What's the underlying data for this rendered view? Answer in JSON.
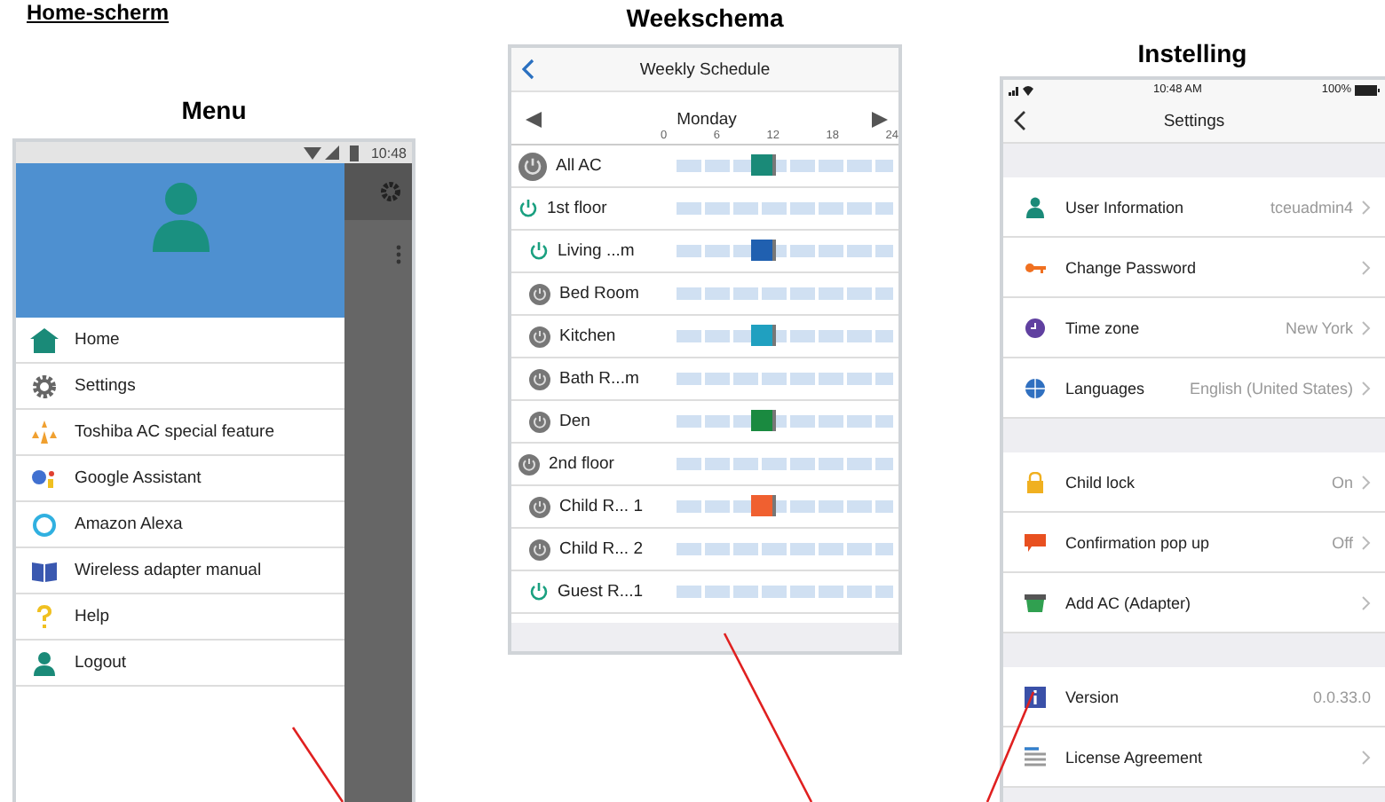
{
  "page_heading": "Home-scherm",
  "menu": {
    "heading": "Menu",
    "status_time": "10:48",
    "items": [
      {
        "kind": "home",
        "label": "Home"
      },
      {
        "kind": "gear",
        "label": "Settings"
      },
      {
        "kind": "stars",
        "label": "Toshiba AC special feature"
      },
      {
        "kind": "dots",
        "label": "Google Assistant"
      },
      {
        "kind": "ring",
        "label": "Amazon Alexa"
      },
      {
        "kind": "book",
        "label": "Wireless adapter manual"
      },
      {
        "kind": "question",
        "label": "Help"
      },
      {
        "kind": "person",
        "label": "Logout"
      }
    ]
  },
  "schedule": {
    "heading": "Weekschema",
    "title": "Weekly Schedule",
    "day": "Monday",
    "ticks": [
      "0",
      "6",
      "12",
      "18",
      "24"
    ],
    "rows": [
      {
        "name": "All AC",
        "on": false,
        "color": "#1a8a78",
        "children": []
      },
      {
        "name": "1st floor",
        "on": true,
        "children": [
          {
            "name": "Living ...m",
            "on": true,
            "color": "#2060b0"
          },
          {
            "name": "Bed Room",
            "on": false
          },
          {
            "name": "Kitchen",
            "on": false,
            "color": "#20a0c0"
          },
          {
            "name": "Bath R...m",
            "on": false
          },
          {
            "name": "Den",
            "on": false,
            "color": "#1a8a40"
          }
        ]
      },
      {
        "name": "2nd floor",
        "on": false,
        "children": [
          {
            "name": "Child R... 1",
            "on": false,
            "color": "#f06030"
          },
          {
            "name": "Child R... 2",
            "on": false
          },
          {
            "name": "Guest R...1",
            "on": true
          }
        ]
      }
    ]
  },
  "settings": {
    "heading": "Instelling",
    "status_time": "10:48 AM",
    "battery": "100%",
    "title": "Settings",
    "groups": [
      [
        {
          "kind": "person",
          "label": "User Information",
          "value": "tceuadmin4",
          "chevron": true
        },
        {
          "kind": "key",
          "label": "Change Password",
          "chevron": true
        },
        {
          "kind": "clock",
          "label": "Time zone",
          "value": "New York",
          "chevron": true
        },
        {
          "kind": "globe",
          "label": "Languages",
          "value": "English (United States)",
          "chevron": true
        }
      ],
      [
        {
          "kind": "lock",
          "label": "Child lock",
          "value": "On",
          "chevron": true
        },
        {
          "kind": "bubble",
          "label": "Confirmation pop up",
          "value": "Off",
          "chevron": true
        },
        {
          "kind": "adapter",
          "label": "Add AC (Adapter)",
          "chevron": true
        }
      ],
      [
        {
          "kind": "info",
          "label": "Version",
          "value": "0.0.33.0",
          "chevron": false
        },
        {
          "kind": "lines",
          "label": "License Agreement",
          "chevron": true
        }
      ]
    ]
  }
}
